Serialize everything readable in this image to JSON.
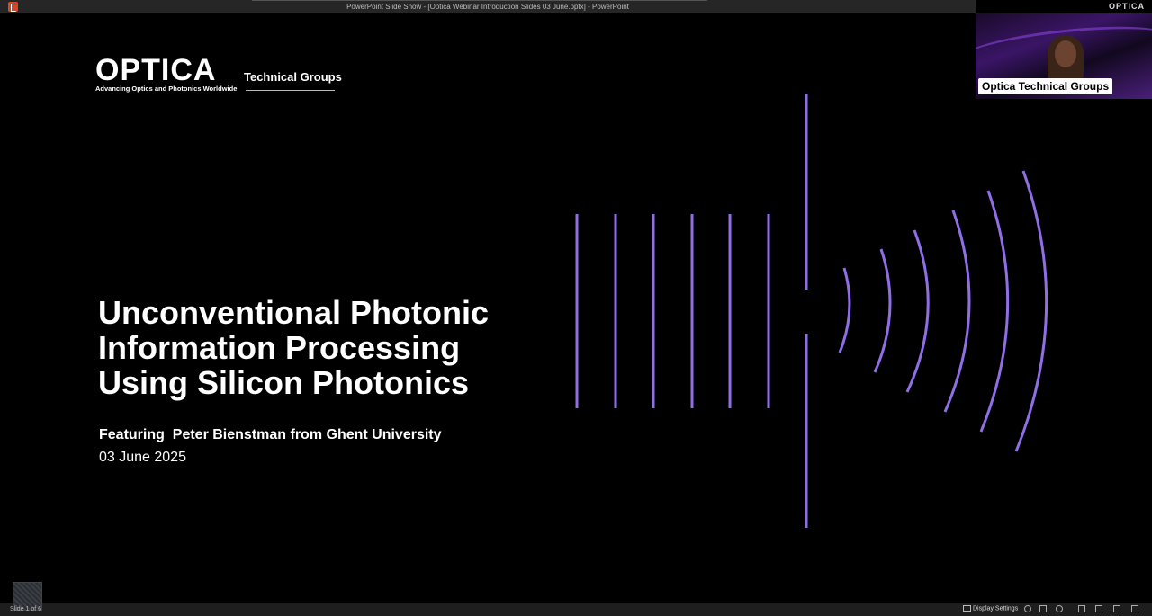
{
  "window": {
    "title": "PowerPoint Slide Show - [Optica Webinar Introduction Slides 03 June.pptx] - PowerPoint",
    "corner_brand": "OPTICA"
  },
  "slide": {
    "logo_text": "OPTICA",
    "logo_tagline": "Advancing Optics and Photonics Worldwide",
    "section_label": "Technical Groups",
    "title_lines": [
      "Unconventional Photonic",
      "Information Processing",
      "Using Silicon Photonics"
    ],
    "featuring": "Featuring  Peter Bienstman from Ghent University",
    "date": "03 June 2025",
    "accent_color": "#8f6ee8"
  },
  "video": {
    "participant_name": "Optica Technical Groups"
  },
  "statusbar": {
    "slide_count": "Slide 1 of 6",
    "display_settings": "Display Settings"
  }
}
